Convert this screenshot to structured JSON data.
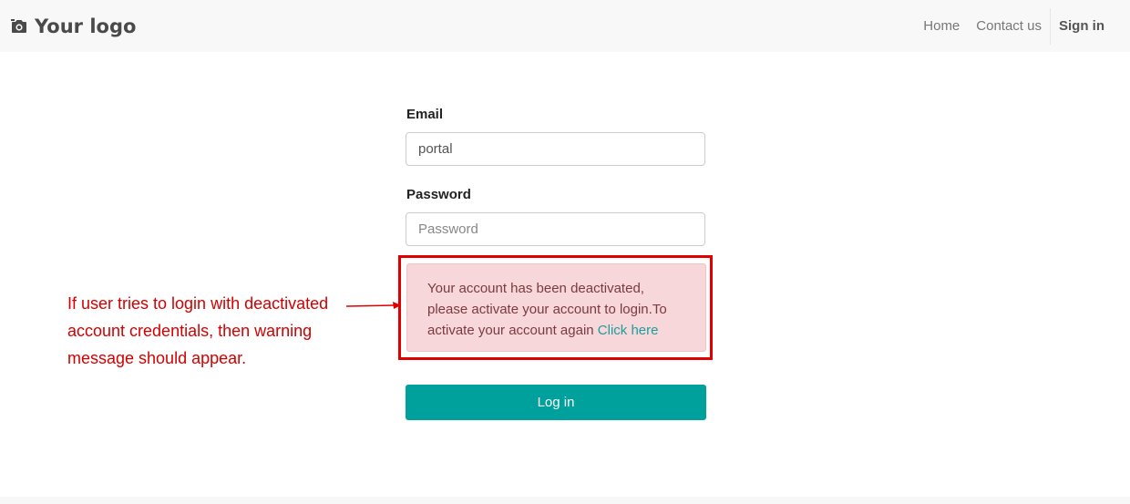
{
  "header": {
    "logo_text": "Your logo",
    "logo_icon": "camera-icon",
    "nav": {
      "home": "Home",
      "contact": "Contact us",
      "signin": "Sign in"
    }
  },
  "form": {
    "email_label": "Email",
    "email_value": "portal",
    "password_label": "Password",
    "password_placeholder": "Password",
    "login_button": "Log in"
  },
  "alert": {
    "message": "Your account has been deactivated, please activate your account to login.To activate your account again",
    "link_text": "Click here"
  },
  "annotation": {
    "text": "If user tries to login with deactivated account credentials, then warning message should appear."
  },
  "colors": {
    "accent": "#00a09d",
    "alert_bg": "#f8d7da",
    "annotation_red": "#e00000"
  }
}
